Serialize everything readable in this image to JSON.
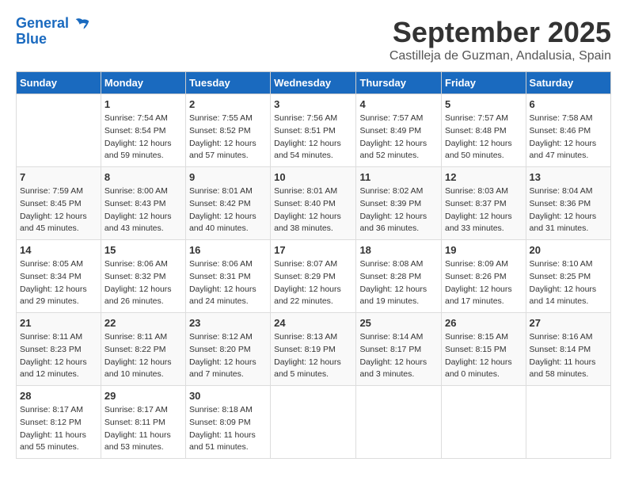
{
  "header": {
    "logo_line1": "General",
    "logo_line2": "Blue",
    "month": "September 2025",
    "location": "Castilleja de Guzman, Andalusia, Spain"
  },
  "weekdays": [
    "Sunday",
    "Monday",
    "Tuesday",
    "Wednesday",
    "Thursday",
    "Friday",
    "Saturday"
  ],
  "weeks": [
    [
      {
        "day": "",
        "info": ""
      },
      {
        "day": "1",
        "info": "Sunrise: 7:54 AM\nSunset: 8:54 PM\nDaylight: 12 hours\nand 59 minutes."
      },
      {
        "day": "2",
        "info": "Sunrise: 7:55 AM\nSunset: 8:52 PM\nDaylight: 12 hours\nand 57 minutes."
      },
      {
        "day": "3",
        "info": "Sunrise: 7:56 AM\nSunset: 8:51 PM\nDaylight: 12 hours\nand 54 minutes."
      },
      {
        "day": "4",
        "info": "Sunrise: 7:57 AM\nSunset: 8:49 PM\nDaylight: 12 hours\nand 52 minutes."
      },
      {
        "day": "5",
        "info": "Sunrise: 7:57 AM\nSunset: 8:48 PM\nDaylight: 12 hours\nand 50 minutes."
      },
      {
        "day": "6",
        "info": "Sunrise: 7:58 AM\nSunset: 8:46 PM\nDaylight: 12 hours\nand 47 minutes."
      }
    ],
    [
      {
        "day": "7",
        "info": "Sunrise: 7:59 AM\nSunset: 8:45 PM\nDaylight: 12 hours\nand 45 minutes."
      },
      {
        "day": "8",
        "info": "Sunrise: 8:00 AM\nSunset: 8:43 PM\nDaylight: 12 hours\nand 43 minutes."
      },
      {
        "day": "9",
        "info": "Sunrise: 8:01 AM\nSunset: 8:42 PM\nDaylight: 12 hours\nand 40 minutes."
      },
      {
        "day": "10",
        "info": "Sunrise: 8:01 AM\nSunset: 8:40 PM\nDaylight: 12 hours\nand 38 minutes."
      },
      {
        "day": "11",
        "info": "Sunrise: 8:02 AM\nSunset: 8:39 PM\nDaylight: 12 hours\nand 36 minutes."
      },
      {
        "day": "12",
        "info": "Sunrise: 8:03 AM\nSunset: 8:37 PM\nDaylight: 12 hours\nand 33 minutes."
      },
      {
        "day": "13",
        "info": "Sunrise: 8:04 AM\nSunset: 8:36 PM\nDaylight: 12 hours\nand 31 minutes."
      }
    ],
    [
      {
        "day": "14",
        "info": "Sunrise: 8:05 AM\nSunset: 8:34 PM\nDaylight: 12 hours\nand 29 minutes."
      },
      {
        "day": "15",
        "info": "Sunrise: 8:06 AM\nSunset: 8:32 PM\nDaylight: 12 hours\nand 26 minutes."
      },
      {
        "day": "16",
        "info": "Sunrise: 8:06 AM\nSunset: 8:31 PM\nDaylight: 12 hours\nand 24 minutes."
      },
      {
        "day": "17",
        "info": "Sunrise: 8:07 AM\nSunset: 8:29 PM\nDaylight: 12 hours\nand 22 minutes."
      },
      {
        "day": "18",
        "info": "Sunrise: 8:08 AM\nSunset: 8:28 PM\nDaylight: 12 hours\nand 19 minutes."
      },
      {
        "day": "19",
        "info": "Sunrise: 8:09 AM\nSunset: 8:26 PM\nDaylight: 12 hours\nand 17 minutes."
      },
      {
        "day": "20",
        "info": "Sunrise: 8:10 AM\nSunset: 8:25 PM\nDaylight: 12 hours\nand 14 minutes."
      }
    ],
    [
      {
        "day": "21",
        "info": "Sunrise: 8:11 AM\nSunset: 8:23 PM\nDaylight: 12 hours\nand 12 minutes."
      },
      {
        "day": "22",
        "info": "Sunrise: 8:11 AM\nSunset: 8:22 PM\nDaylight: 12 hours\nand 10 minutes."
      },
      {
        "day": "23",
        "info": "Sunrise: 8:12 AM\nSunset: 8:20 PM\nDaylight: 12 hours\nand 7 minutes."
      },
      {
        "day": "24",
        "info": "Sunrise: 8:13 AM\nSunset: 8:19 PM\nDaylight: 12 hours\nand 5 minutes."
      },
      {
        "day": "25",
        "info": "Sunrise: 8:14 AM\nSunset: 8:17 PM\nDaylight: 12 hours\nand 3 minutes."
      },
      {
        "day": "26",
        "info": "Sunrise: 8:15 AM\nSunset: 8:15 PM\nDaylight: 12 hours\nand 0 minutes."
      },
      {
        "day": "27",
        "info": "Sunrise: 8:16 AM\nSunset: 8:14 PM\nDaylight: 11 hours\nand 58 minutes."
      }
    ],
    [
      {
        "day": "28",
        "info": "Sunrise: 8:17 AM\nSunset: 8:12 PM\nDaylight: 11 hours\nand 55 minutes."
      },
      {
        "day": "29",
        "info": "Sunrise: 8:17 AM\nSunset: 8:11 PM\nDaylight: 11 hours\nand 53 minutes."
      },
      {
        "day": "30",
        "info": "Sunrise: 8:18 AM\nSunset: 8:09 PM\nDaylight: 11 hours\nand 51 minutes."
      },
      {
        "day": "",
        "info": ""
      },
      {
        "day": "",
        "info": ""
      },
      {
        "day": "",
        "info": ""
      },
      {
        "day": "",
        "info": ""
      }
    ]
  ]
}
